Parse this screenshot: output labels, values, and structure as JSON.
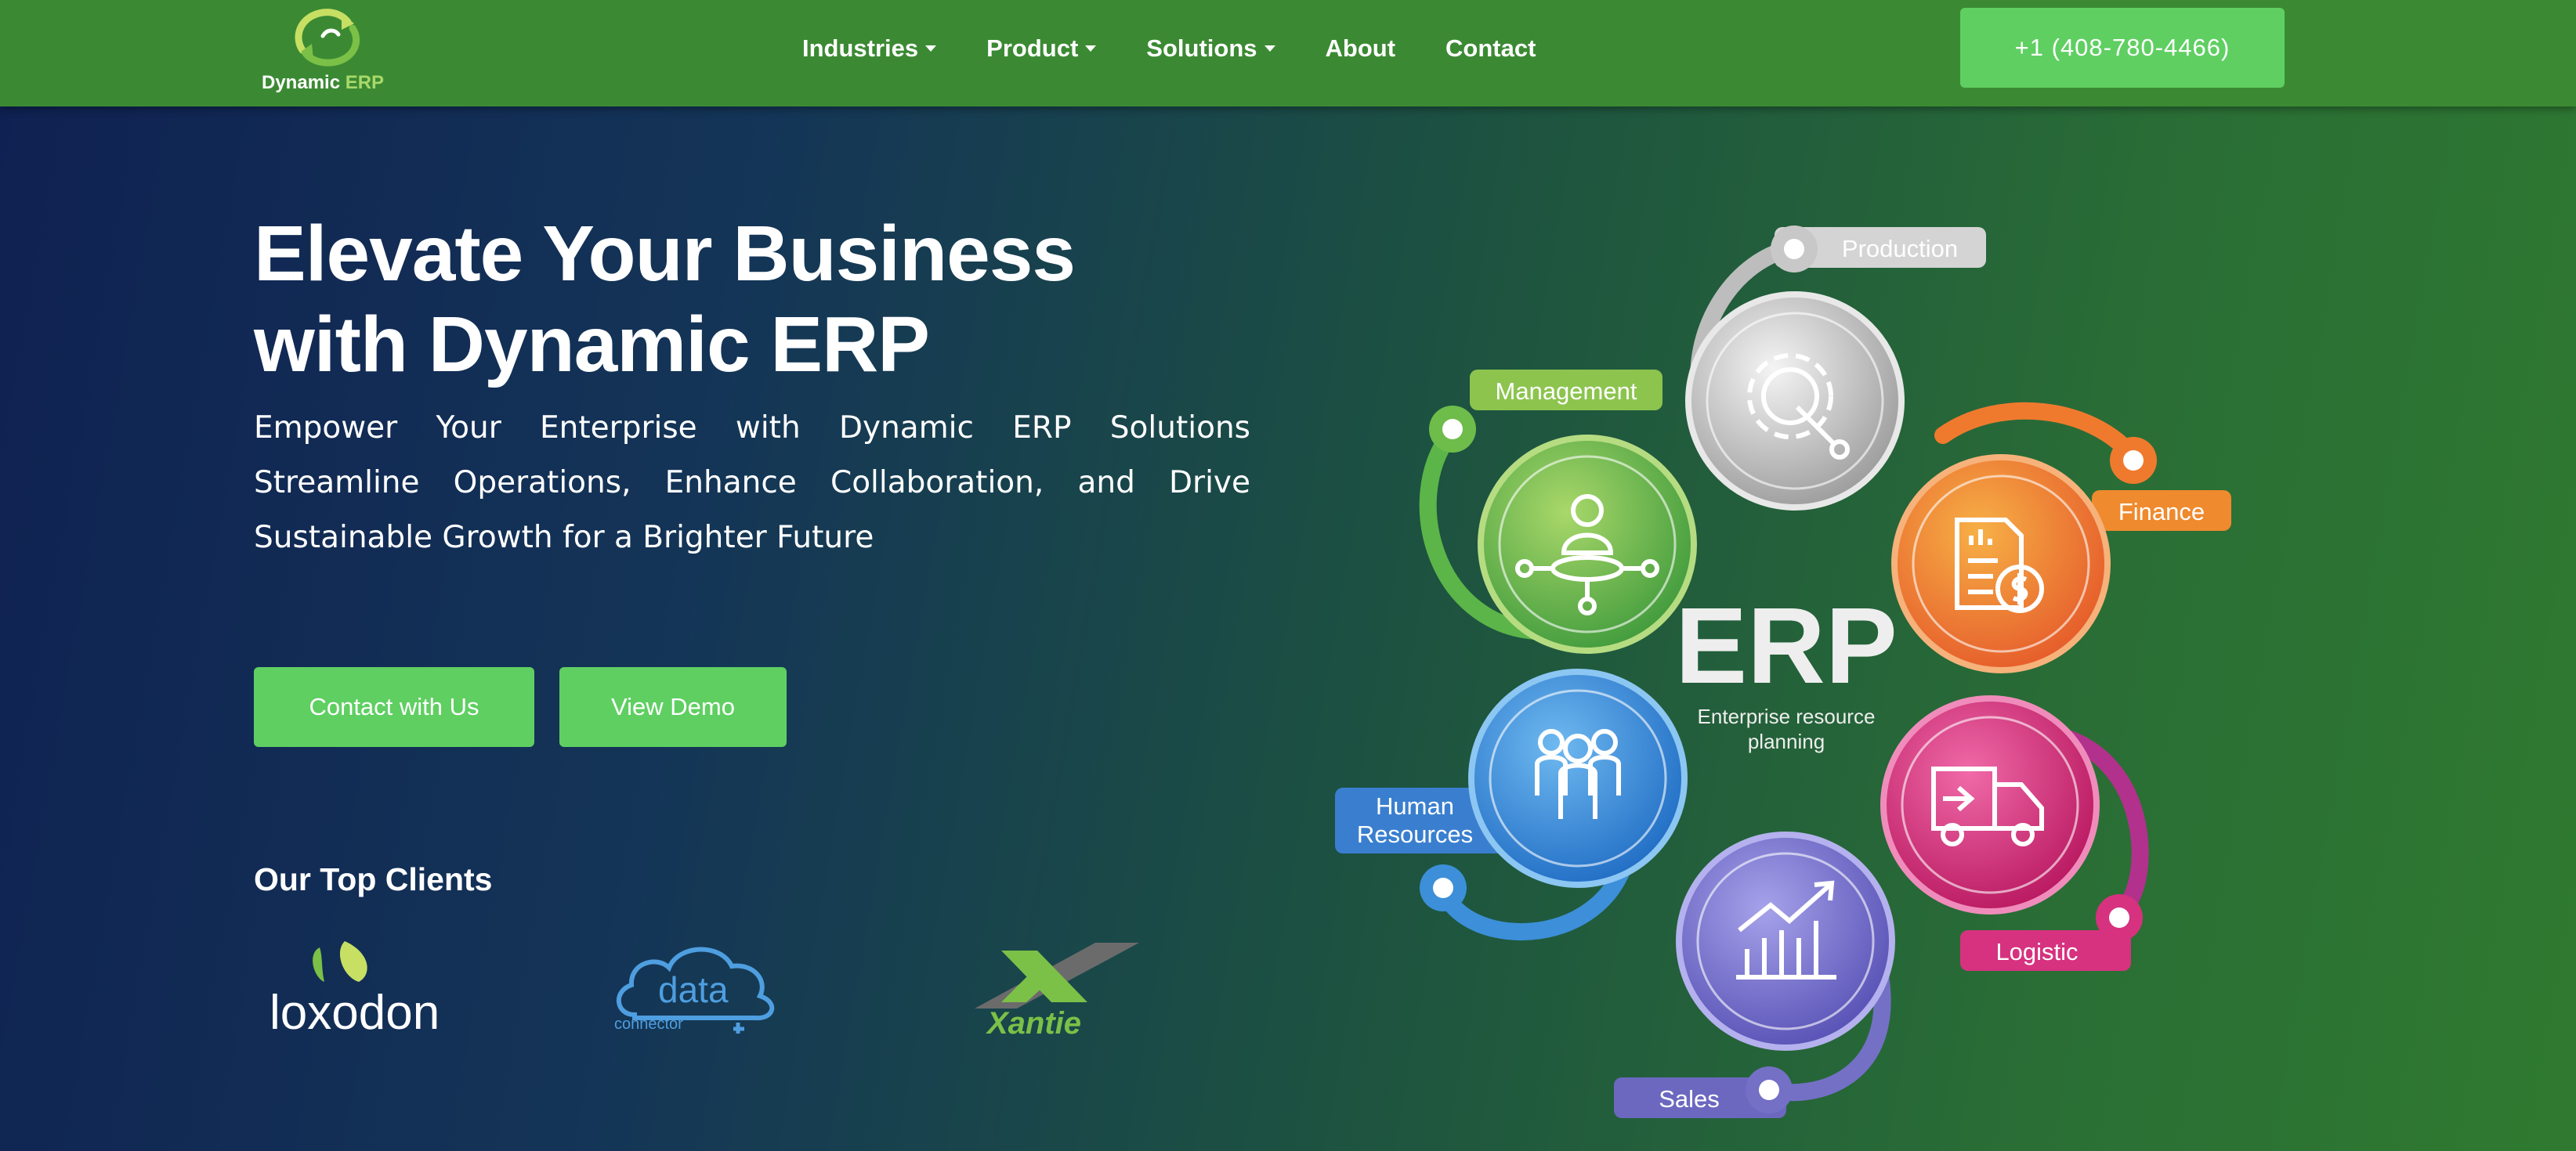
{
  "brand": {
    "name": "Dynamic",
    "suffix": "ERP"
  },
  "nav": {
    "items": [
      {
        "label": "Industries",
        "dropdown": true
      },
      {
        "label": "Product",
        "dropdown": true
      },
      {
        "label": "Solutions",
        "dropdown": true
      },
      {
        "label": "About",
        "dropdown": false
      },
      {
        "label": "Contact",
        "dropdown": false
      }
    ],
    "phone": "+1 (408-780-4466)"
  },
  "hero": {
    "title_line1": "Elevate Your Business",
    "title_line2": "with Dynamic ERP",
    "subtitle": "Empower Your Enterprise with Dynamic ERP Solutions Streamline Operations, Enhance Collaboration, and Drive Sustainable Growth for a Brighter Future",
    "contact_button": "Contact with Us",
    "demo_button": "View Demo"
  },
  "clients": {
    "heading": "Our Top Clients",
    "logos": [
      {
        "text": "loxodon"
      },
      {
        "text": "data",
        "subtext": "connector"
      },
      {
        "text": "Xantie"
      }
    ]
  },
  "diagram": {
    "center_title": "ERP",
    "center_line1": "Enterprise resource",
    "center_line2": "planning",
    "modules": [
      {
        "label": "Production",
        "icon": "gear-wrench-icon",
        "color": "#c9c9c9"
      },
      {
        "label": "Management",
        "icon": "manager-network-icon",
        "color": "#7bc047"
      },
      {
        "label": "Finance",
        "icon": "invoice-coin-icon",
        "color": "#ef8a2e"
      },
      {
        "label": "Human",
        "label2": "Resources",
        "icon": "people-group-icon",
        "color": "#3c8fd8"
      },
      {
        "label": "Logistic",
        "icon": "delivery-truck-icon",
        "color": "#d6327f"
      },
      {
        "label": "Sales",
        "icon": "growth-chart-icon",
        "color": "#7470c6"
      }
    ]
  },
  "colors": {
    "header_green": "#3b8a33",
    "button_green": "#5fcf62",
    "hero_dark_blue": "#0f2152",
    "hero_green": "#2f7a30"
  }
}
